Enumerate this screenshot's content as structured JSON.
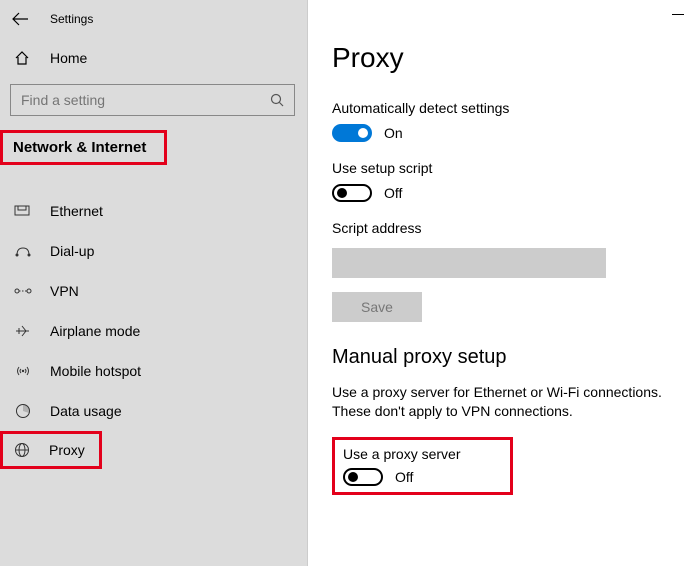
{
  "titlebar": {
    "title": "Settings"
  },
  "sidebar": {
    "home": "Home",
    "search_placeholder": "Find a setting",
    "section": "Network & Internet",
    "items": [
      {
        "label": "Ethernet"
      },
      {
        "label": "Dial-up"
      },
      {
        "label": "VPN"
      },
      {
        "label": "Airplane mode"
      },
      {
        "label": "Mobile hotspot"
      },
      {
        "label": "Data usage"
      },
      {
        "label": "Proxy"
      }
    ]
  },
  "page": {
    "title": "Proxy",
    "auto_detect_label": "Automatically detect settings",
    "auto_detect_state": "On",
    "setup_script_label": "Use setup script",
    "setup_script_state": "Off",
    "script_address_label": "Script address",
    "script_address_value": "",
    "save_label": "Save",
    "manual_heading": "Manual proxy setup",
    "manual_desc": "Use a proxy server for Ethernet or Wi-Fi connections. These don't apply to VPN connections.",
    "use_proxy_label": "Use a proxy server",
    "use_proxy_state": "Off"
  }
}
